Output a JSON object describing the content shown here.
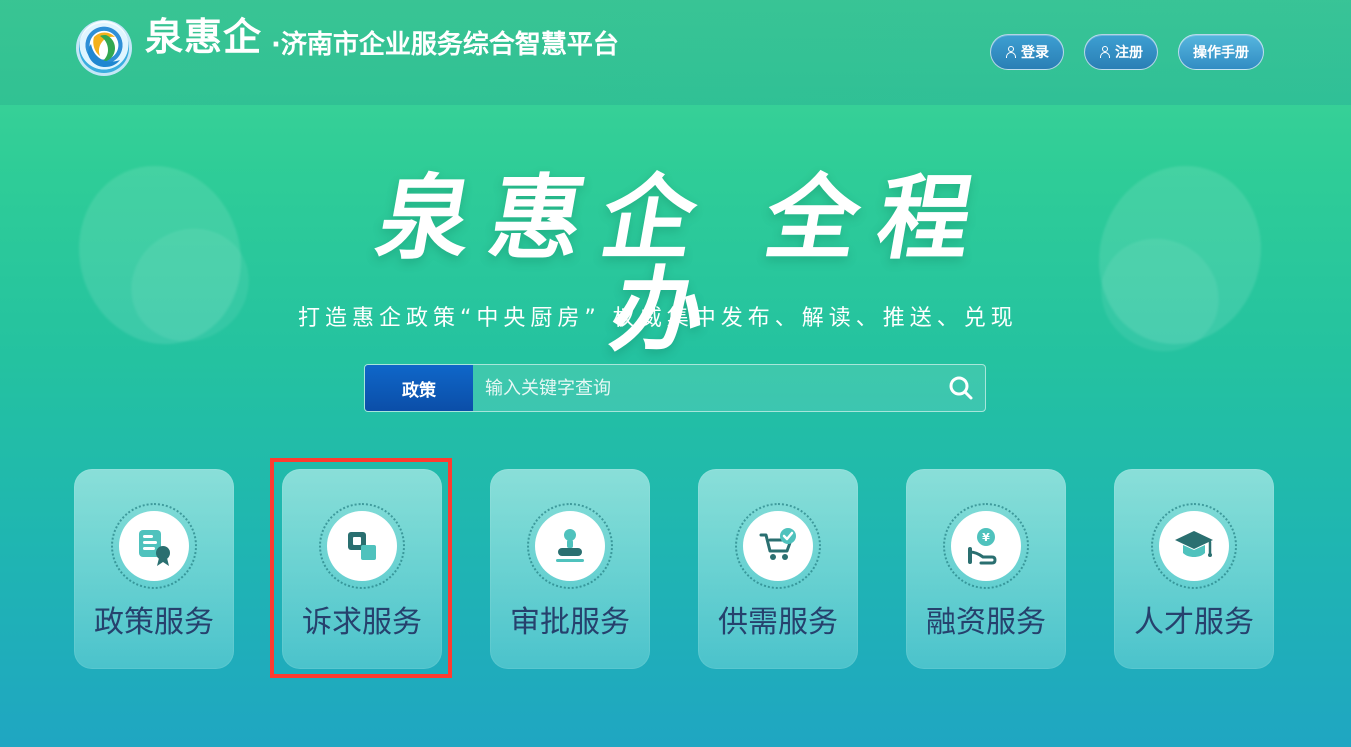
{
  "header": {
    "brand_title": "泉惠企",
    "brand_subtitle": "·济南市企业服务综合智慧平台",
    "actions": [
      {
        "label": "登录",
        "icon": "user-icon"
      },
      {
        "label": "注册",
        "icon": "user-icon"
      },
      {
        "label": "操作手册",
        "icon": ""
      }
    ]
  },
  "hero": {
    "slogan": "泉惠企 全程办",
    "tagline": "打造惠企政策“中央厨房”  权威集中发布、解读、推送、兑现"
  },
  "search": {
    "type_label": "政策",
    "placeholder": "输入关键字查询",
    "icon": "search-icon"
  },
  "services": [
    {
      "label": "政策服务",
      "icon": "policy-document-icon"
    },
    {
      "label": "诉求服务",
      "icon": "request-box-icon"
    },
    {
      "label": "审批服务",
      "icon": "approval-stamp-icon"
    },
    {
      "label": "供需服务",
      "icon": "shopping-cart-check-icon"
    },
    {
      "label": "融资服务",
      "icon": "finance-hand-yuan-icon"
    },
    {
      "label": "人才服务",
      "icon": "graduation-cap-icon"
    }
  ],
  "colors": {
    "accent_teal": "#2cb9a1",
    "accent_blue": "#0f67c9",
    "highlight_red": "#ff3b30",
    "icon_dark": "#2a6f70",
    "icon_light": "#4fc2bd"
  }
}
